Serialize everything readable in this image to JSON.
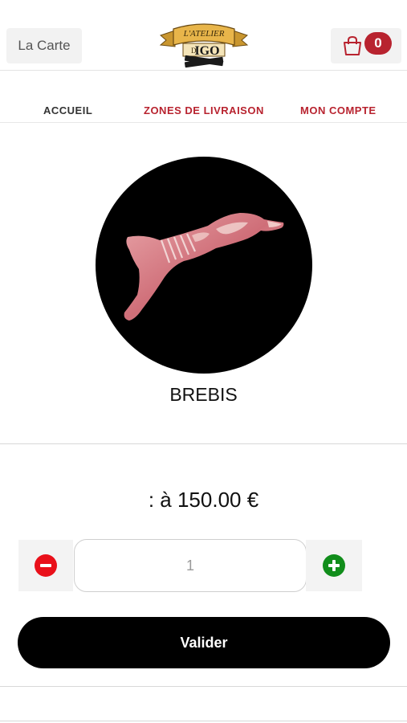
{
  "header": {
    "menu_label": "La Carte",
    "logo_text_top": "L'ATELIER",
    "logo_text_de": "D'",
    "logo_text_main": "IGO",
    "cart_count": "0"
  },
  "nav": {
    "items": [
      {
        "label": "ACCUEIL"
      },
      {
        "label": "ZONES DE LIVRAISON"
      },
      {
        "label": "MON COMPTE"
      }
    ]
  },
  "product": {
    "name": "BREBIS",
    "price": ": à 150.00 €",
    "quantity": "1"
  },
  "actions": {
    "submit_label": "Valider"
  },
  "colors": {
    "accent": "#b8232f",
    "minus": "#e9101a",
    "plus": "#118d1b",
    "button_bg": "#000000"
  }
}
